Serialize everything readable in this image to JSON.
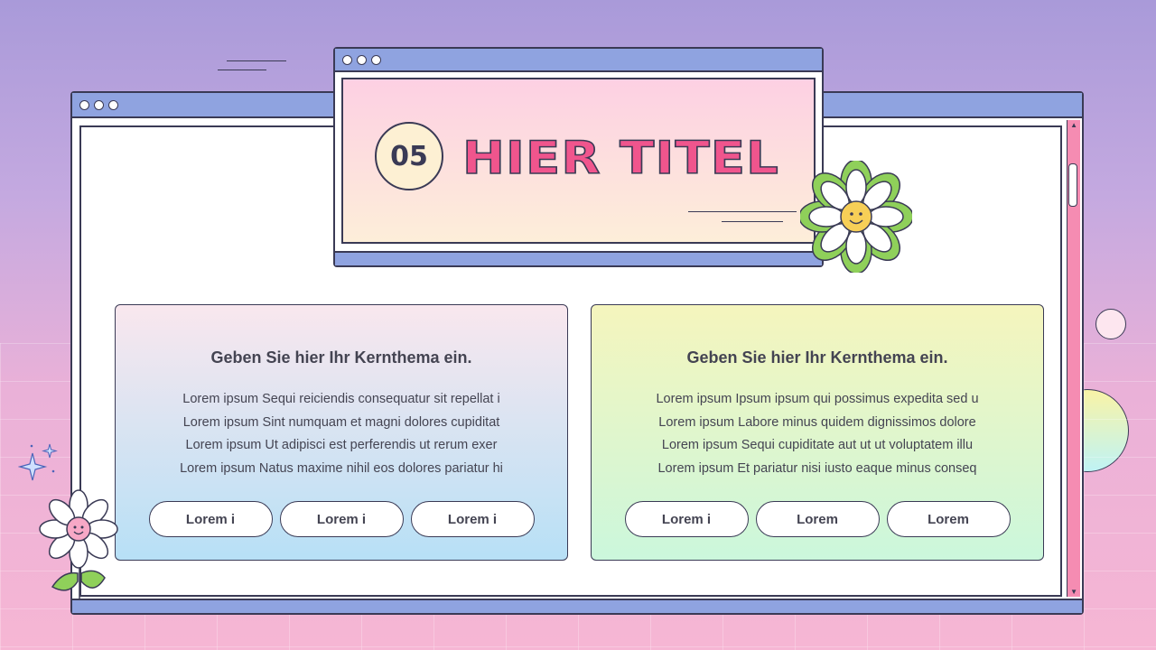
{
  "window": {
    "title_number": "05",
    "title": "HIER TITEL"
  },
  "cards": [
    {
      "heading": "Geben Sie hier Ihr Kernthema ein.",
      "lines": [
        "Lorem ipsum Sequi reiciendis consequatur sit repellat i",
        "Lorem ipsum Sint numquam et magni dolores cupiditat",
        "Lorem ipsum Ut adipisci est perferendis ut rerum exer",
        "Lorem ipsum Natus maxime nihil eos dolores pariatur hi"
      ],
      "buttons": [
        "Lorem i",
        "Lorem i",
        "Lorem i"
      ]
    },
    {
      "heading": "Geben Sie hier Ihr Kernthema ein.",
      "lines": [
        "Lorem ipsum Ipsum ipsum qui possimus expedita sed u",
        "Lorem ipsum Labore minus quidem dignissimos dolore",
        "Lorem ipsum Sequi cupiditate aut ut ut voluptatem illu",
        "Lorem ipsum Et pariatur nisi iusto eaque minus conseq"
      ],
      "buttons": [
        "Lorem i",
        "Lorem",
        "Lorem"
      ]
    }
  ],
  "colors": {
    "accent_pink": "#f0558d",
    "window_bar": "#8fa3e0",
    "outline": "#3a3a55"
  },
  "icons": {
    "window_controls": "three-dots-icon",
    "flower": "smiley-daisy-icon",
    "sparkle": "sparkle-icon"
  }
}
